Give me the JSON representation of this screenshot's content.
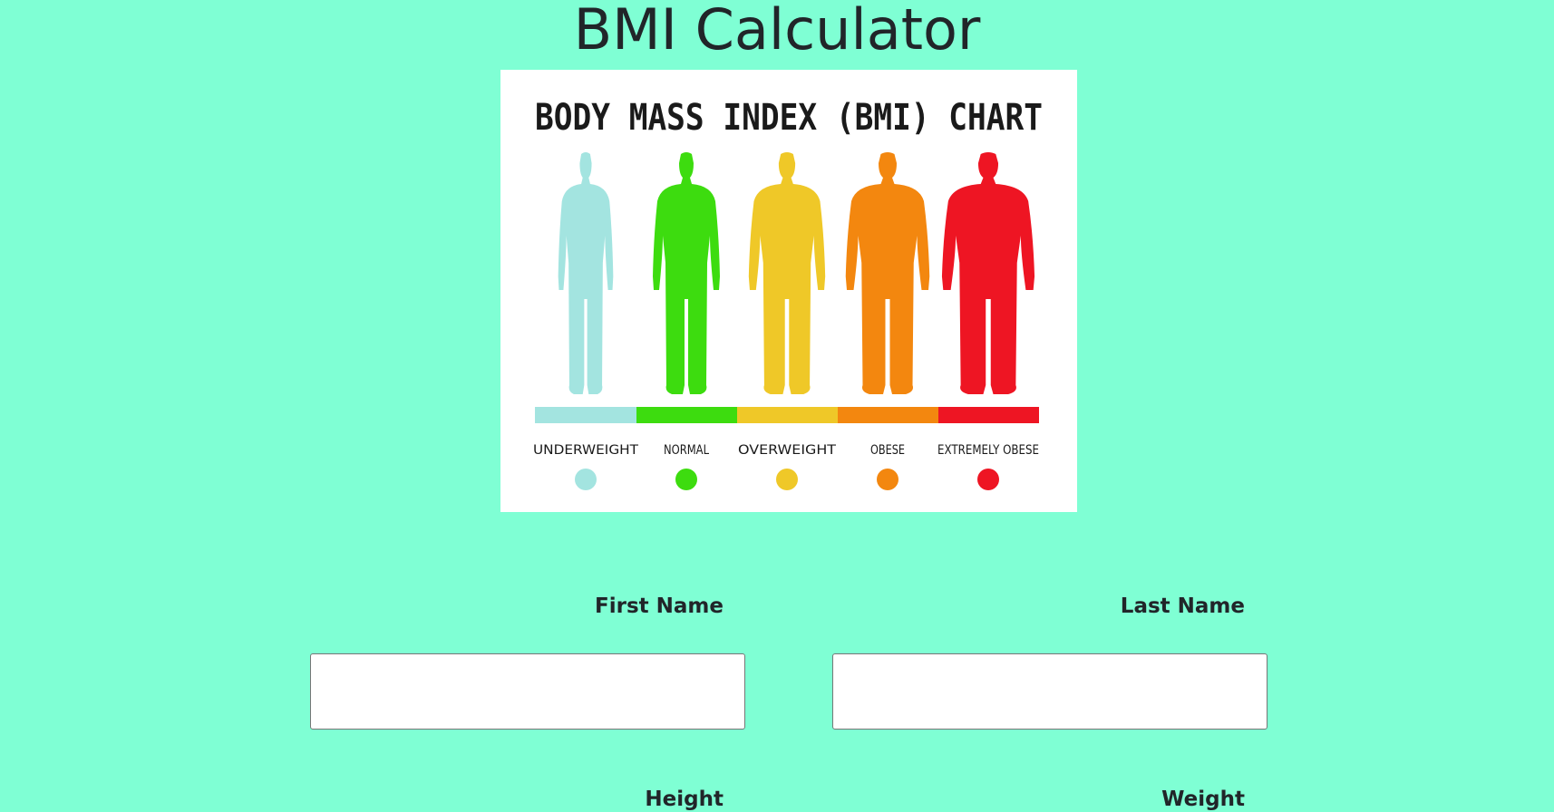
{
  "page": {
    "title": "BMI Calculator"
  },
  "bmi_chart_image": {
    "heading": "BODY MASS INDEX (BMI) CHART",
    "categories": [
      {
        "label": "UNDERWEIGHT",
        "color": "#a3e4e0"
      },
      {
        "label": "NORMAL",
        "color": "#3ddc0f"
      },
      {
        "label": "OVERWEIGHT",
        "color": "#efc828"
      },
      {
        "label": "OBESE",
        "color": "#f3870f"
      },
      {
        "label": "EXTREMELY OBESE",
        "color": "#ee1523"
      }
    ]
  },
  "form": {
    "first_name": {
      "label": "First Name",
      "value": ""
    },
    "last_name": {
      "label": "Last Name",
      "value": ""
    },
    "height": {
      "label": "Height"
    },
    "weight": {
      "label": "Weight"
    }
  },
  "colors": {
    "background": "#7fffd4",
    "text": "#212529"
  }
}
